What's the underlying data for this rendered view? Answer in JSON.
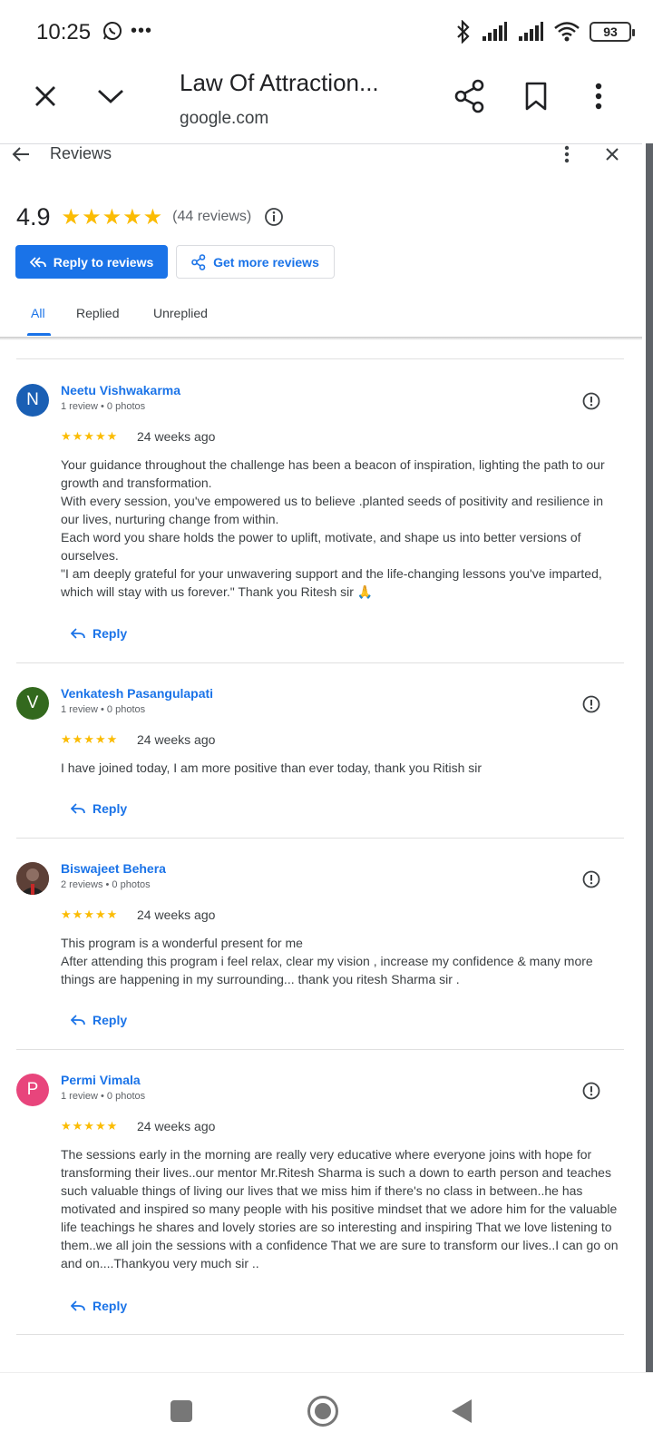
{
  "status_bar": {
    "time": "10:25",
    "battery": "93",
    "signal_sub": "4",
    "wifi_sub": "6"
  },
  "browser": {
    "title": "Law Of Attraction...",
    "domain": "google.com"
  },
  "panel": {
    "title": "Reviews",
    "rating": "4.9",
    "stars": "★★★★★",
    "review_count": "(44 reviews)",
    "reply_button": "Reply to reviews",
    "more_button": "Get more reviews",
    "tabs": [
      "All",
      "Replied",
      "Unreplied"
    ]
  },
  "reviews": [
    {
      "initial": "N",
      "avatar_color": "#1a5fb4",
      "name": "Neetu Vishwakarma",
      "meta": "1 review • 0 photos",
      "stars": "★★★★★",
      "age": "24 weeks ago",
      "text": "Your guidance throughout the challenge has been a beacon of inspiration, lighting the path to our growth and transformation.\nWith every session, you've empowered us to believe .planted seeds of positivity and resilience in our lives, nurturing change from within.\nEach word you share holds the power to uplift, motivate, and shape us into better versions of ourselves.\n\"I am deeply grateful for your unwavering support and the life-changing lessons you've imparted, which will stay with us forever.\" Thank you Ritesh sir 🙏",
      "reply": "Reply"
    },
    {
      "initial": "V",
      "avatar_color": "#33691e",
      "name": "Venkatesh Pasangulapati",
      "meta": "1 review • 0 photos",
      "stars": "★★★★★",
      "age": "24 weeks ago",
      "text": "I have joined today, I am more positive than ever today, thank you Ritish sir",
      "reply": "Reply"
    },
    {
      "initial": "",
      "avatar_color": "#4e342e",
      "name": "Biswajeet Behera",
      "meta": "2 reviews • 0 photos",
      "stars": "★★★★★",
      "age": "24 weeks ago",
      "text": "This program is a wonderful present for me\nAfter attending this program i feel relax, clear my vision , increase my confidence & many more things are happening in my surrounding... thank you ritesh Sharma sir .",
      "reply": "Reply"
    },
    {
      "initial": "P",
      "avatar_color": "#e8457c",
      "name": "Permi Vimala",
      "meta": "1 review • 0 photos",
      "stars": "★★★★★",
      "age": "24 weeks ago",
      "text": "The sessions early in the morning are really very educative where everyone joins with hope for transforming their lives..our mentor Mr.Ritesh Sharma is such a down to earth person and teaches such valuable things of living our lives that we miss him if there's no class in between..he has motivated and inspired so many people with his positive mindset that we adore him for the valuable life teachings he shares and lovely stories are so interesting and inspiring That we love listening to them..we all join the sessions with a confidence That we are sure to transform our lives..I can go on and on....Thankyou very much sir ..",
      "reply": "Reply"
    }
  ]
}
